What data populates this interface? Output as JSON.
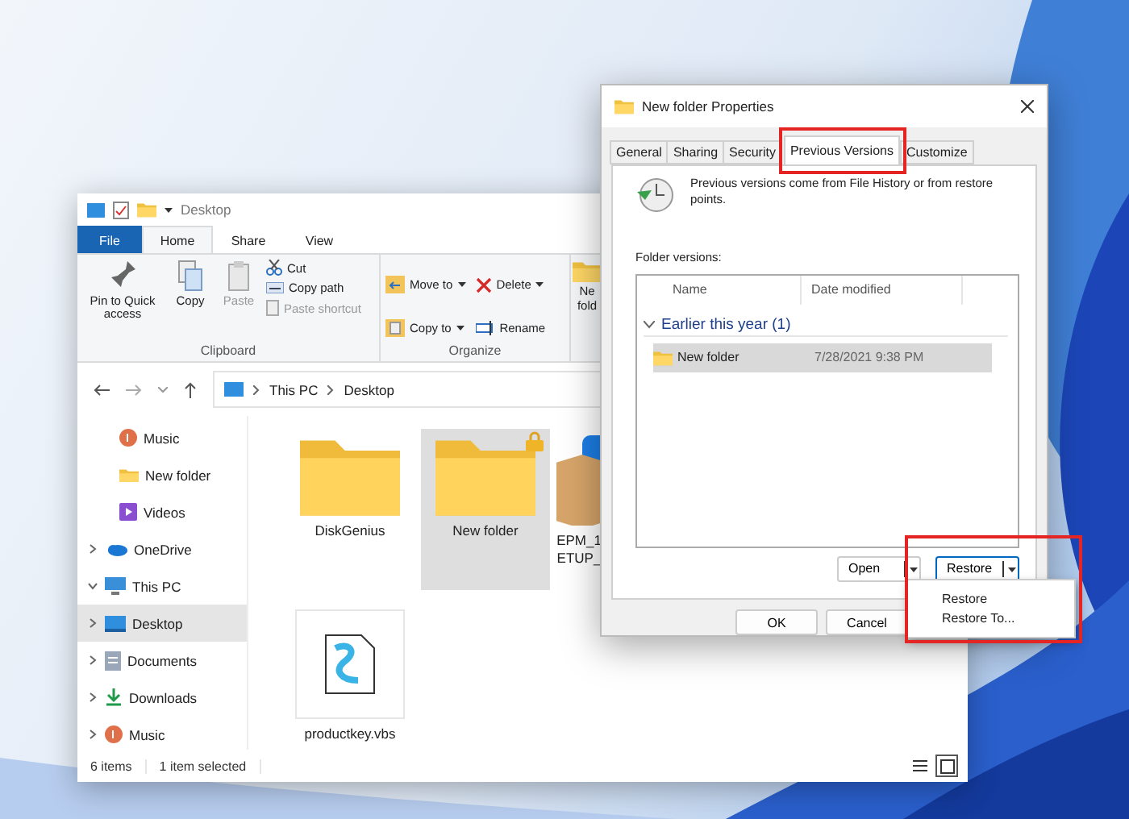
{
  "explorer": {
    "title": "Desktop",
    "ribbon_tabs": [
      {
        "label": "File",
        "kind": "file",
        "selected": false
      },
      {
        "label": "Home",
        "kind": "tab",
        "selected": true
      },
      {
        "label": "Share",
        "kind": "tab",
        "selected": false
      },
      {
        "label": "View",
        "kind": "tab",
        "selected": false
      }
    ],
    "clipboard": {
      "label": "Clipboard",
      "large": [
        {
          "label": "Pin to Quick access",
          "kind": "pin",
          "disabled": false
        },
        {
          "label": "Copy",
          "kind": "copy",
          "disabled": false
        },
        {
          "label": "Paste",
          "kind": "paste",
          "disabled": true
        }
      ],
      "small": [
        {
          "label": "Cut",
          "kind": "cut",
          "disabled": false
        },
        {
          "label": "Copy path",
          "kind": "path",
          "disabled": false
        },
        {
          "label": "Paste shortcut",
          "kind": "shortcut",
          "disabled": true
        }
      ]
    },
    "organize": {
      "label": "Organize",
      "items": [
        {
          "label": "Move to",
          "kind": "move",
          "dropdown": true
        },
        {
          "label": "Copy to",
          "kind": "copyto",
          "dropdown": true
        },
        {
          "label": "Delete",
          "kind": "delete",
          "dropdown": true
        },
        {
          "label": "Rename",
          "kind": "rename",
          "dropdown": false
        }
      ]
    },
    "new_group": {
      "label": "Ne fold"
    },
    "address": {
      "path": [
        "This PC",
        "Desktop"
      ]
    },
    "sidebar": [
      {
        "label": "Music",
        "kind": "music",
        "selected": false
      },
      {
        "label": "New folder",
        "kind": "folder",
        "selected": false
      },
      {
        "label": "Videos",
        "kind": "videos",
        "selected": false
      },
      {
        "label": "OneDrive",
        "kind": "cloud",
        "selected": false,
        "expanded": false
      },
      {
        "label": "This PC",
        "kind": "pc",
        "selected": false,
        "expanded": true,
        "children": [
          {
            "label": "Desktop",
            "kind": "desktop",
            "selected": true,
            "expanded": false
          },
          {
            "label": "Documents",
            "kind": "documents",
            "selected": false,
            "expanded": false
          },
          {
            "label": "Downloads",
            "kind": "downloads",
            "selected": false,
            "expanded": false
          },
          {
            "label": "Music",
            "kind": "music",
            "selected": false,
            "expanded": false
          }
        ]
      }
    ],
    "files": [
      {
        "name": "DiskGenius",
        "kind": "folder",
        "selected": false,
        "locked": false
      },
      {
        "name": "New folder",
        "kind": "folder",
        "selected": true,
        "locked": true
      },
      {
        "name": "EPM_1 ETUP_",
        "kind": "package",
        "selected": false,
        "locked": false
      },
      {
        "name": "productkey.vbs",
        "kind": "script",
        "selected": false,
        "locked": false
      }
    ],
    "status": [
      "6 items",
      "1 item selected"
    ],
    "views": [
      {
        "kind": "details",
        "selected": false
      },
      {
        "kind": "icons",
        "selected": true
      }
    ]
  },
  "dialog": {
    "title": "New folder Properties",
    "tabs": [
      {
        "label": "General",
        "selected": false
      },
      {
        "label": "Sharing",
        "selected": false
      },
      {
        "label": "Security",
        "selected": false
      },
      {
        "label": "Previous Versions",
        "selected": true
      },
      {
        "label": "Customize",
        "selected": false
      }
    ],
    "info": "Previous versions come from File History or from restore points.",
    "versions_label": "Folder versions:",
    "columns": [
      "Name",
      "Date modified"
    ],
    "groups": [
      {
        "label": "Earlier this year (1)",
        "expanded": true,
        "rows": [
          {
            "name": "New folder",
            "date": "7/28/2021 9:38 PM",
            "selected": true
          }
        ]
      }
    ],
    "actions": [
      {
        "label": "Open",
        "focused": false
      },
      {
        "label": "Restore",
        "focused": true
      }
    ],
    "footer": [
      "OK",
      "Cancel"
    ]
  },
  "menu": [
    "Restore",
    "Restore To..."
  ]
}
